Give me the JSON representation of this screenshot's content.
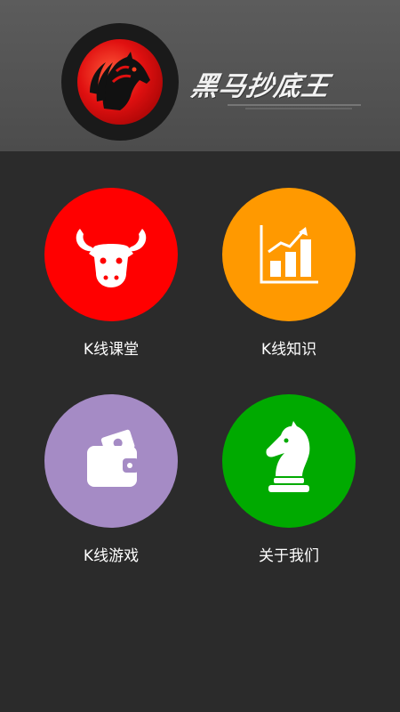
{
  "header": {
    "brand_name": "黑马抄底王",
    "logo_icon": "horse-head-icon",
    "background": "#555555"
  },
  "menu": {
    "items": [
      {
        "label": "K线课堂",
        "icon": "bull-head-icon",
        "color": "#ff0000"
      },
      {
        "label": "K线知识",
        "icon": "bar-chart-icon",
        "color": "#ff9900"
      },
      {
        "label": "K线游戏",
        "icon": "wallet-icon",
        "color": "#a58bc5"
      },
      {
        "label": "关于我们",
        "icon": "chess-knight-icon",
        "color": "#00aa00"
      }
    ]
  }
}
